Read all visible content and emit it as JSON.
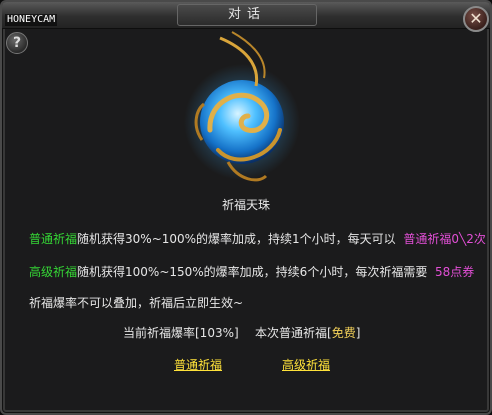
{
  "window": {
    "title": "对话",
    "watermark": "HONEYCAM"
  },
  "help_glyph": "?",
  "close_glyph": "✕",
  "item": {
    "name": "祈福天珠"
  },
  "rules": {
    "normal": {
      "name": "普通祈福",
      "text": "随机获得30%~100%的爆率加成，持续1个小时，每天可以",
      "quota": "普通祈福0╲2次"
    },
    "advanced": {
      "name": "高级祈福",
      "text": "随机获得100%~150%的爆率加成，持续6个小时，每次祈福需要",
      "cost": "58点券"
    },
    "note": "祈福爆率不可以叠加，祈福后立即生效~"
  },
  "status": {
    "current_rate_label": "当前祈福爆率[103%]",
    "normal_cost_prefix": "本次普通祈福[",
    "normal_cost_value": "免费",
    "normal_cost_suffix": "]"
  },
  "actions": {
    "normal_label": "普通祈福",
    "advanced_label": "高级祈福"
  },
  "colors": {
    "highlight_green": "#35d635",
    "highlight_pink": "#e24fd6",
    "link_yellow": "#ffe23a",
    "orb_blue": "#3fb2ff",
    "orb_gold": "#d9a53a"
  },
  "icons": [
    "question-icon",
    "close-icon",
    "blessing-orb-icon"
  ]
}
